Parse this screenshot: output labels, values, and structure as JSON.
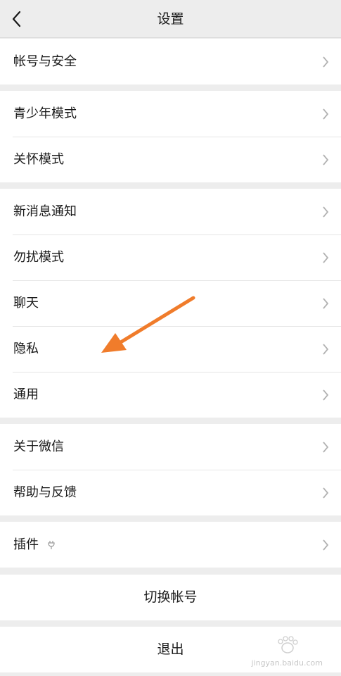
{
  "nav": {
    "title": "设置",
    "back_icon": "chevron-left-icon"
  },
  "groups": [
    {
      "items": [
        {
          "label": "帐号与安全"
        }
      ]
    },
    {
      "items": [
        {
          "label": "青少年模式"
        },
        {
          "label": "关怀模式"
        }
      ]
    },
    {
      "items": [
        {
          "label": "新消息通知"
        },
        {
          "label": "勿扰模式"
        },
        {
          "label": "聊天"
        },
        {
          "label": "隐私"
        },
        {
          "label": "通用"
        }
      ]
    },
    {
      "items": [
        {
          "label": "关于微信"
        },
        {
          "label": "帮助与反馈"
        }
      ]
    },
    {
      "items": [
        {
          "label": "插件",
          "icon": "plugin-icon"
        }
      ]
    }
  ],
  "actions": {
    "switch_account": "切换帐号",
    "logout": "退出"
  },
  "annotation": {
    "color": "#f07c2b",
    "points_to": "隐私"
  },
  "watermark": {
    "text": "jingyan.baidu.com"
  },
  "colors": {
    "background": "#ededed",
    "row": "#ffffff",
    "chevron": "#b2b2b2",
    "text": "#191919"
  }
}
